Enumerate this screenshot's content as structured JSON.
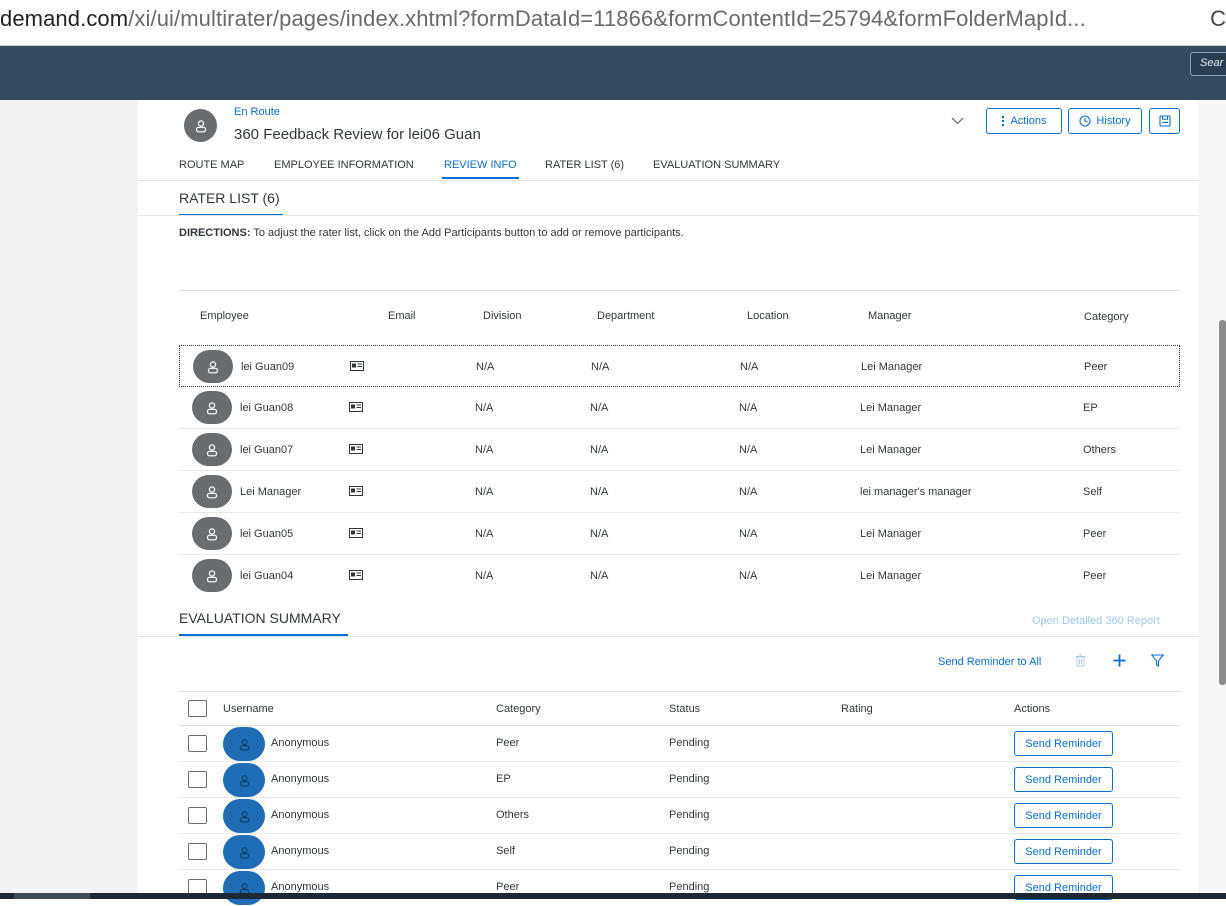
{
  "browser": {
    "url_host": "demand.com",
    "url_path": "/xi/ui/multirater/pages/index.xhtml?formDataId=11866&formContentId=25794&formFolderMapId...",
    "edge_glyph": "C"
  },
  "shell": {
    "search_placeholder": "Sear"
  },
  "header": {
    "status": "En Route",
    "title": "360 Feedback Review for lei06 Guan",
    "actions_label": "Actions",
    "history_label": "History"
  },
  "tabs": [
    {
      "label": "ROUTE MAP"
    },
    {
      "label": "EMPLOYEE INFORMATION"
    },
    {
      "label": "REVIEW INFO",
      "active": true
    },
    {
      "label": "RATER LIST (6)"
    },
    {
      "label": "EVALUATION SUMMARY"
    }
  ],
  "rater_list": {
    "title": "RATER LIST (6)",
    "directions_label": "DIRECTIONS:",
    "directions_text": " To adjust the rater list, click on the Add Participants button to add or remove participants.",
    "columns": [
      "Employee",
      "Email",
      "Division",
      "Department",
      "Location",
      "Manager",
      "Category"
    ],
    "rows": [
      {
        "name": "lei Guan09",
        "division": "N/A",
        "department": "N/A",
        "location": "N/A",
        "manager": "Lei Manager",
        "category": "Peer"
      },
      {
        "name": "lei Guan08",
        "division": "N/A",
        "department": "N/A",
        "location": "N/A",
        "manager": "Lei Manager",
        "category": "EP"
      },
      {
        "name": "lei Guan07",
        "division": "N/A",
        "department": "N/A",
        "location": "N/A",
        "manager": "Lei Manager",
        "category": "Others"
      },
      {
        "name": "Lei Manager",
        "division": "N/A",
        "department": "N/A",
        "location": "N/A",
        "manager": "lei manager's manager",
        "category": "Self"
      },
      {
        "name": "lei Guan05",
        "division": "N/A",
        "department": "N/A",
        "location": "N/A",
        "manager": "Lei Manager",
        "category": "Peer"
      },
      {
        "name": "lei Guan04",
        "division": "N/A",
        "department": "N/A",
        "location": "N/A",
        "manager": "Lei Manager",
        "category": "Peer"
      }
    ]
  },
  "evaluation_summary": {
    "title": "EVALUATION SUMMARY",
    "open_report": "Open Detailed 360 Report",
    "send_all": "Send Reminder to All",
    "columns": [
      "Username",
      "Category",
      "Status",
      "Rating",
      "Actions"
    ],
    "rows": [
      {
        "username": "Anonymous",
        "category": "Peer",
        "status": "Pending",
        "action": "Send Reminder"
      },
      {
        "username": "Anonymous",
        "category": "EP",
        "status": "Pending",
        "action": "Send Reminder"
      },
      {
        "username": "Anonymous",
        "category": "Others",
        "status": "Pending",
        "action": "Send Reminder"
      },
      {
        "username": "Anonymous",
        "category": "Self",
        "status": "Pending",
        "action": "Send Reminder"
      },
      {
        "username": "Anonymous",
        "category": "Peer",
        "status": "Pending",
        "action": "Send Reminder"
      }
    ]
  },
  "colors": {
    "shell": "#354a5f",
    "accent": "#0a6ed1",
    "avatar_gray": "#6a6d70",
    "avatar_blue": "#1f6eb5"
  }
}
